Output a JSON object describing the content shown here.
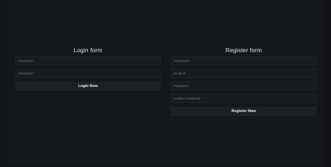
{
  "login": {
    "title": "Login form",
    "username_placeholder": "Username*",
    "password_placeholder": "Password*",
    "submit_label": "Login Now"
  },
  "register": {
    "title": "Register form",
    "username_placeholder": "Username*",
    "email_placeholder": "Email Id",
    "password_placeholder": "Password*",
    "confirm_password_placeholder": "Confirm Password*",
    "submit_label": "Register Now"
  },
  "colors": {
    "background": "#111317",
    "panel": "#14171c",
    "field_bg": "#171a1f",
    "button_bg": "#1c2025",
    "text": "#e6e7e9"
  }
}
